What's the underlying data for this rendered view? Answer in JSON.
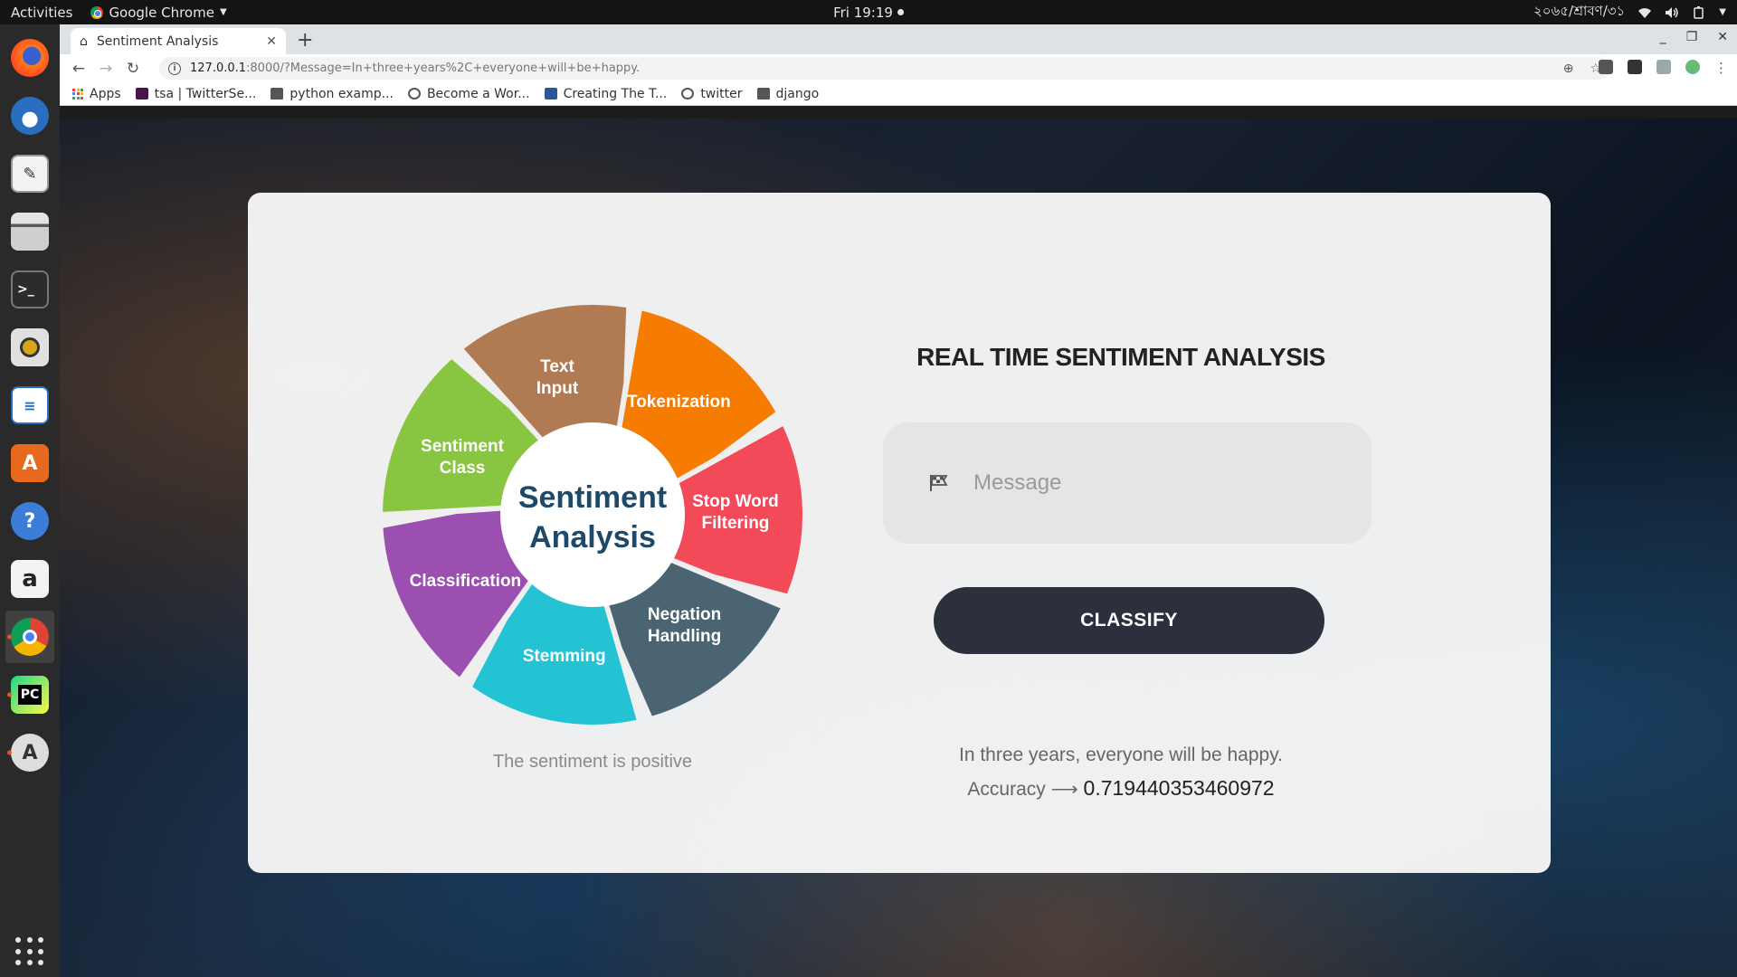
{
  "topbar": {
    "activities": "Activities",
    "app_name": "Google Chrome",
    "clock": "Fri 19:19",
    "date_label": "২০৬৫/শ্রাবণ/৩১"
  },
  "launcher": {
    "items": [
      "firefox-icon",
      "thunderbird-icon",
      "text-editor-icon",
      "files-icon",
      "terminal-icon",
      "rhythmbox-icon",
      "libreoffice-writer-icon",
      "software-center-icon",
      "help-icon",
      "amazon-icon",
      "chrome-icon",
      "pycharm-icon",
      "software-updater-icon"
    ]
  },
  "browser": {
    "tab_title": "Sentiment Analysis",
    "url_host": "127.0.0.1",
    "url_rest": ":8000/?Message=In+three+years%2C+everyone+will+be+happy.",
    "bookmarks": [
      {
        "label": "Apps",
        "icon": "apps-grid-icon"
      },
      {
        "label": "tsa | TwitterSe...",
        "icon": "slack-icon"
      },
      {
        "label": "python examp...",
        "icon": "folder-icon"
      },
      {
        "label": "Become a Wor...",
        "icon": "globe-icon"
      },
      {
        "label": "Creating The T...",
        "icon": "page-icon"
      },
      {
        "label": "twitter",
        "icon": "globe-icon"
      },
      {
        "label": "django",
        "icon": "folder-icon"
      }
    ]
  },
  "page": {
    "wheel": {
      "center_line1": "Sentiment",
      "center_line2": "Analysis",
      "segments": [
        {
          "label1": "Text",
          "label2": "Input",
          "color": "#b07a52"
        },
        {
          "label1": "Tokenization",
          "label2": "",
          "color": "#f57c00"
        },
        {
          "label1": "Stop Word",
          "label2": "Filtering",
          "color": "#f24a59"
        },
        {
          "label1": "Negation",
          "label2": "Handling",
          "color": "#4a6472"
        },
        {
          "label1": "Stemming",
          "label2": "",
          "color": "#23c3d3"
        },
        {
          "label1": "Classification",
          "label2": "",
          "color": "#9b4fb0"
        },
        {
          "label1": "Sentiment",
          "label2": "Class",
          "color": "#88c540"
        }
      ],
      "center_text_color": "#1d4a6b"
    },
    "sentiment_result": "The sentiment is positive",
    "title": "REAL TIME SENTIMENT ANALYSIS",
    "message_placeholder": "Message",
    "classify_label": "CLASSIFY",
    "result_sentence": "In three years, everyone will be happy.",
    "accuracy_label": "Accuracy",
    "accuracy_arrow": "⟶",
    "accuracy_value": "0.719440353460972"
  }
}
